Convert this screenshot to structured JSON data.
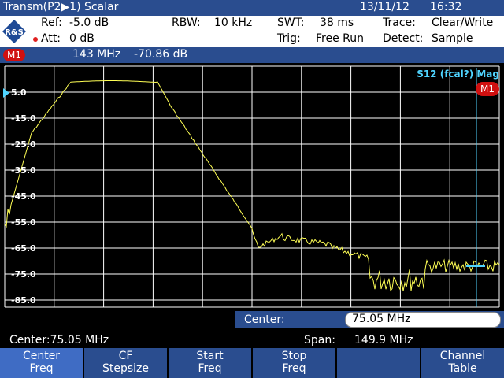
{
  "titlebar": {
    "title": "Transm(P2▶1) Scalar",
    "date": "13/11/12",
    "time": "16:32"
  },
  "params": {
    "ref_label": "Ref:",
    "ref_value": "-5.0 dB",
    "att_label": "Att:",
    "att_value": "0 dB",
    "rbw_label": "RBW:",
    "rbw_value": "10 kHz",
    "swt_label": "SWT:",
    "swt_value": "38 ms",
    "trig_label": "Trig:",
    "trig_value": "Free Run",
    "trace_label": "Trace:",
    "trace_value": "Clear/Write",
    "detect_label": "Detect:",
    "detect_value": "Sample",
    "logo_text": "R&S"
  },
  "marker": {
    "badge": "M1",
    "freq": "143 MHz",
    "level": "-70.86 dB"
  },
  "plot": {
    "trace_name": "S12 (fcal?) Mag",
    "marker_badge": "M1",
    "y_labels": [
      "5.0",
      "-15.0",
      "-25.0",
      "-35.0",
      "-45.0",
      "-55.0",
      "-65.0",
      "-75.0",
      "-85.0"
    ],
    "trace_color": "#ffff55",
    "grid_color": "#ffffff"
  },
  "entry": {
    "label": "Center:",
    "value": "75.05 MHz"
  },
  "status": {
    "center": "Center:75.05 MHz",
    "span_label": "Span:",
    "span_value": "149.9 MHz"
  },
  "softkeys": [
    {
      "line1": "Center",
      "line2": "Freq"
    },
    {
      "line1": "CF",
      "line2": "Stepsize"
    },
    {
      "line1": "Start",
      "line2": "Freq"
    },
    {
      "line1": "Stop",
      "line2": "Freq"
    },
    {
      "line1": "",
      "line2": ""
    },
    {
      "line1": "Channel",
      "line2": "Table"
    }
  ]
}
